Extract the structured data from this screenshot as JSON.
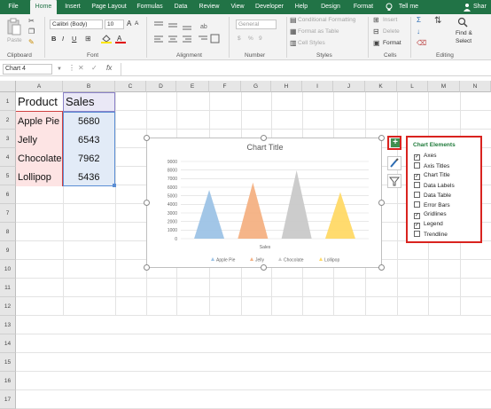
{
  "tabs": [
    "File",
    "Home",
    "Insert",
    "Page Layout",
    "Formulas",
    "Data",
    "Review",
    "View",
    "Developer",
    "Help",
    "Design",
    "Format",
    "Tell me",
    "Shar"
  ],
  "ribbon": {
    "paste_label": "Paste",
    "font_name": "Calibri (Body)",
    "font_size": "10",
    "bold": "B",
    "italic": "I",
    "underline": "U",
    "grow_font": "A",
    "shrink_font": "A",
    "number_format": "General",
    "currency": "$",
    "percent": "%",
    "comma": "9",
    "cond_formatting": "Conditional Formatting",
    "format_as_table": "Format as Table",
    "cell_styles": "Cell Styles",
    "insert": "Insert",
    "delete": "Delete",
    "format": "Format",
    "find_select_1": "Find &",
    "find_select_2": "Select",
    "groups": {
      "clipboard": "Clipboard",
      "font": "Font",
      "alignment": "Alignment",
      "number": "Number",
      "styles": "Styles",
      "cells": "Cells",
      "editing": "Editing"
    }
  },
  "formula_bar": {
    "name_box": "Chart 4",
    "fx": "fx",
    "formula": ""
  },
  "columns": [
    "A",
    "B",
    "C",
    "D",
    "E",
    "F",
    "G",
    "H",
    "I",
    "J",
    "K",
    "L",
    "M",
    "N"
  ],
  "rows": [
    "1",
    "2",
    "3",
    "4",
    "5",
    "6",
    "7",
    "8",
    "9",
    "10",
    "11",
    "12",
    "13",
    "14",
    "15",
    "16",
    "17"
  ],
  "table": {
    "headers": [
      "Product",
      "Sales"
    ],
    "rows": [
      {
        "product": "Apple Pie",
        "sales": "5680"
      },
      {
        "product": "Jelly",
        "sales": "6543"
      },
      {
        "product": "Chocolate",
        "sales": "7962"
      },
      {
        "product": "Lollipop",
        "sales": "5436"
      }
    ]
  },
  "chart_data": {
    "type": "bar",
    "shape": "triangle",
    "title": "Chart Title",
    "xlabel": "Sales",
    "ylabel": "",
    "ylim": [
      0,
      9000
    ],
    "yticks": [
      "9000",
      "8000",
      "7000",
      "6000",
      "5000",
      "4000",
      "3000",
      "2000",
      "1000",
      "0"
    ],
    "grid": true,
    "legend_position": "bottom",
    "series": [
      {
        "name": "Apple Pie",
        "value": 5680,
        "color": "#9dc3e6"
      },
      {
        "name": "Jelly",
        "value": 6543,
        "color": "#f4b183"
      },
      {
        "name": "Chocolate",
        "value": 7962,
        "color": "#c9c9c9"
      },
      {
        "name": "Lollipop",
        "value": 5436,
        "color": "#ffd966"
      }
    ]
  },
  "chart_buttons": {
    "elements": "+",
    "styles": "brush-icon",
    "filters": "funnel-icon"
  },
  "chart_elements_panel": {
    "title": "Chart Elements",
    "items": [
      {
        "label": "Axes",
        "checked": true
      },
      {
        "label": "Axis Titles",
        "checked": false
      },
      {
        "label": "Chart Title",
        "checked": true
      },
      {
        "label": "Data Labels",
        "checked": false
      },
      {
        "label": "Data Table",
        "checked": false
      },
      {
        "label": "Error Bars",
        "checked": false
      },
      {
        "label": "Gridlines",
        "checked": true
      },
      {
        "label": "Legend",
        "checked": true
      },
      {
        "label": "Trendline",
        "checked": false
      }
    ]
  },
  "colors": {
    "excel_green": "#217346",
    "highlight_red": "#d9231f",
    "chart_elements_title": "#1f7a3a"
  }
}
